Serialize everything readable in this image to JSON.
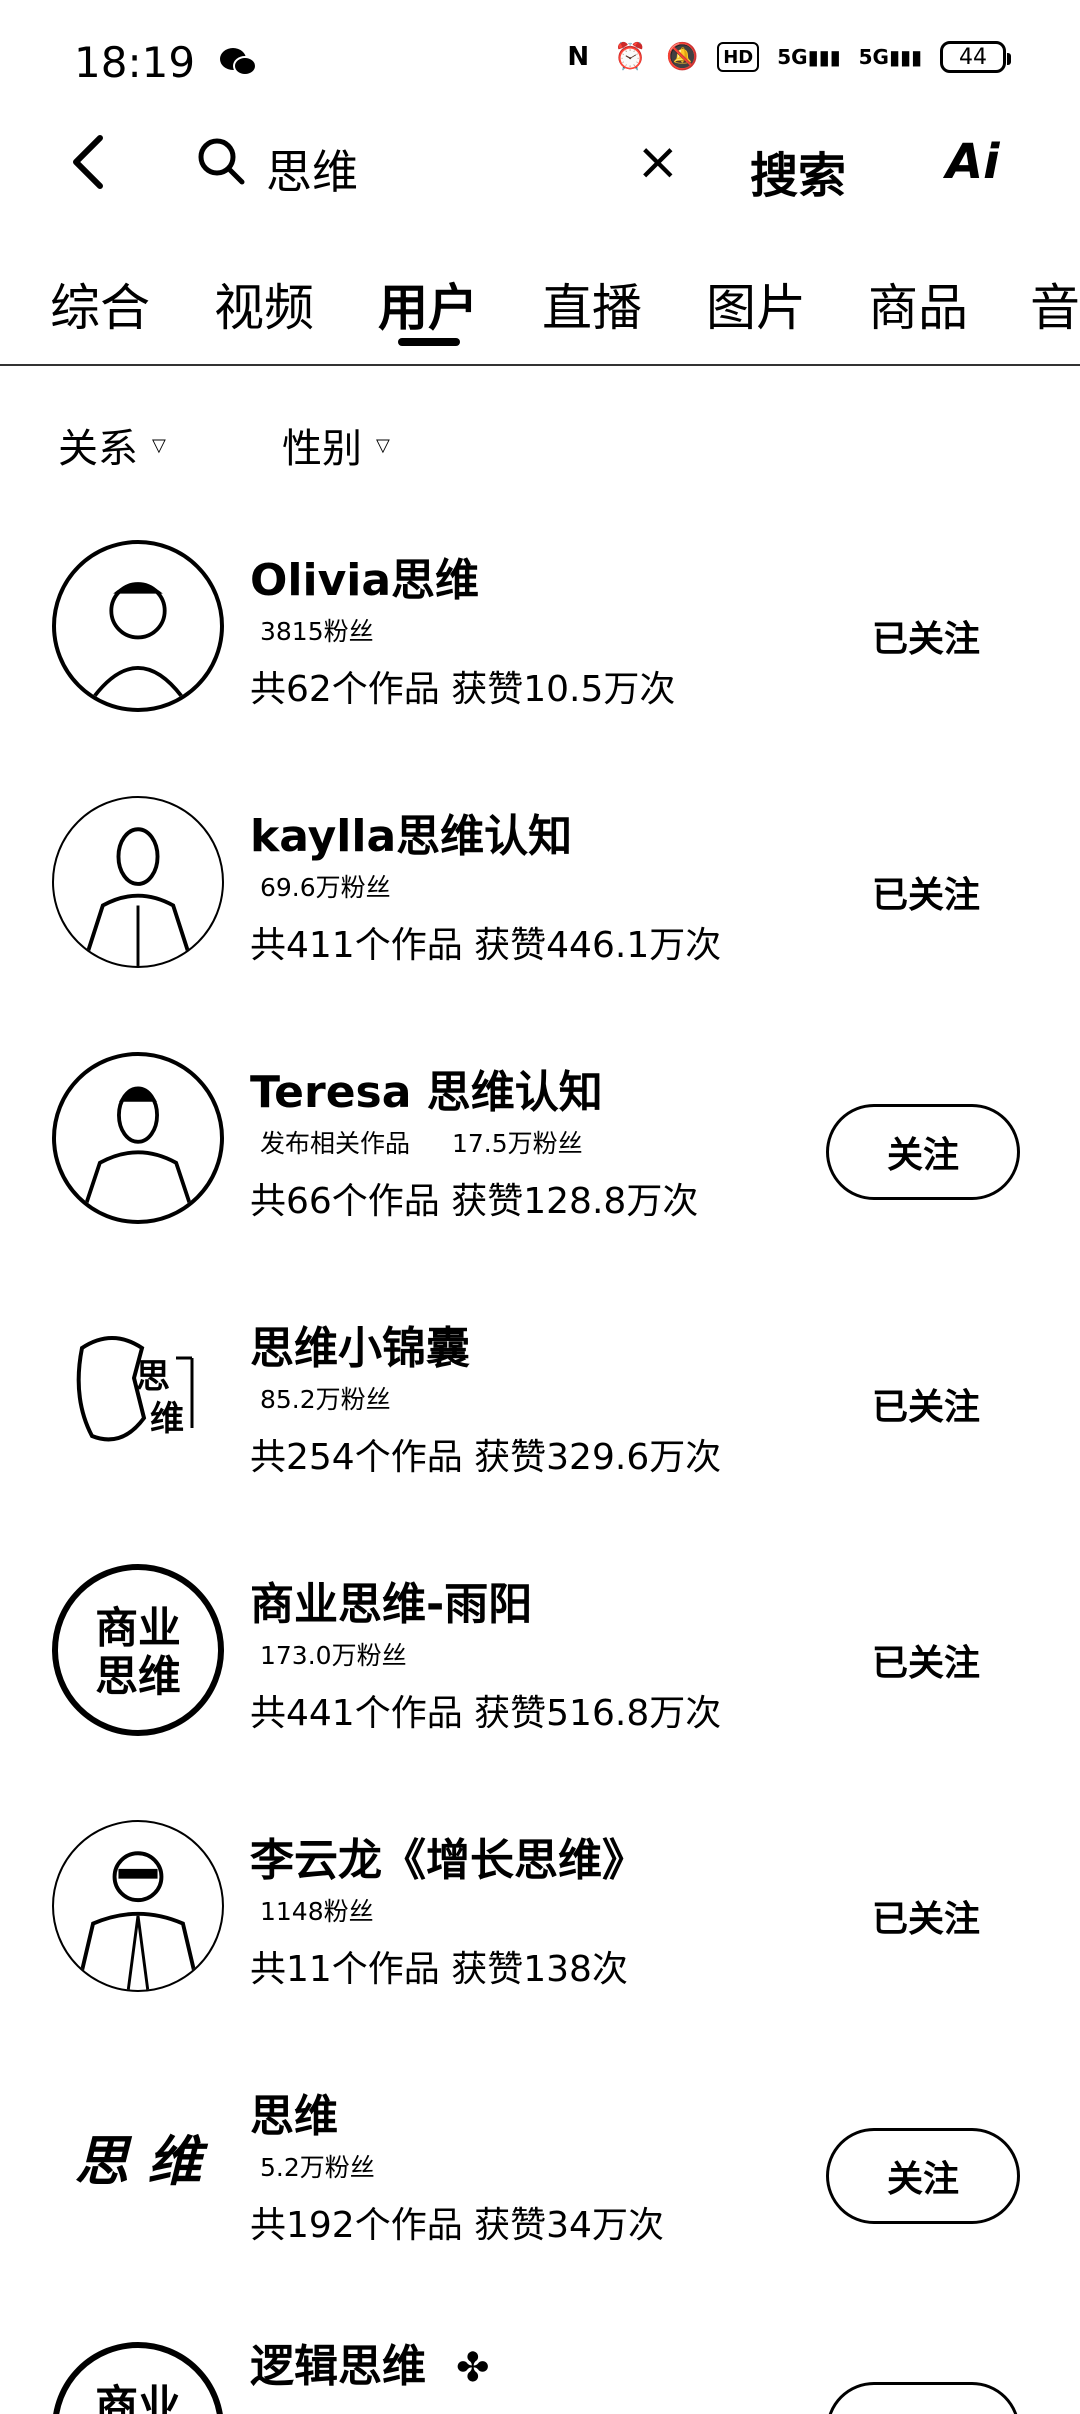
{
  "status": {
    "time": "18:19",
    "battery": "44",
    "signal1": "5G",
    "signal2": "5G"
  },
  "search": {
    "query": "思维",
    "clear_label": "×",
    "search_label": "搜索",
    "ai_label": "Ai"
  },
  "tabs": [
    "综合",
    "视频",
    "用户",
    "直播",
    "图片",
    "商品",
    "音"
  ],
  "filters": [
    "关系",
    "性别"
  ],
  "users": [
    {
      "name": "Olivia思维",
      "published": "",
      "fans": "3815粉丝",
      "works": "共62个作品 获赞10.5万次",
      "action": "已关注",
      "following": true
    },
    {
      "name": "kaylla思维认知",
      "published": "",
      "fans": "69.6万粉丝",
      "works": "共411个作品 获赞446.1万次",
      "action": "已关注",
      "following": true
    },
    {
      "name": "Teresa 思维认知",
      "published": "发布相关作品",
      "fans": "17.5万粉丝",
      "works": "共66个作品 获赞128.8万次",
      "action": "关注",
      "following": false
    },
    {
      "name": "思维小锦囊",
      "published": "",
      "fans": "85.2万粉丝",
      "works": "共254个作品 获赞329.6万次",
      "action": "已关注",
      "following": true
    },
    {
      "name": "商业思维-雨阳",
      "published": "",
      "fans": "173.0万粉丝",
      "works": "共441个作品 获赞516.8万次",
      "action": "已关注",
      "following": true
    },
    {
      "name": "李云龙《增长思维》",
      "published": "",
      "fans": "1148粉丝",
      "works": "共11个作品 获赞138次",
      "action": "已关注",
      "following": true
    },
    {
      "name": "思维",
      "published": "",
      "fans": "5.2万粉丝",
      "works": "共192个作品 获赞34万次",
      "action": "关注",
      "following": false
    },
    {
      "name": "逻辑思维",
      "published": "",
      "fans": "",
      "works": "",
      "action": "",
      "following": false
    }
  ],
  "avatar_texts": {
    "row3": [
      "思",
      "维"
    ],
    "row4": [
      "商业",
      "思维"
    ],
    "row6": "思 维",
    "row7": "商业"
  }
}
